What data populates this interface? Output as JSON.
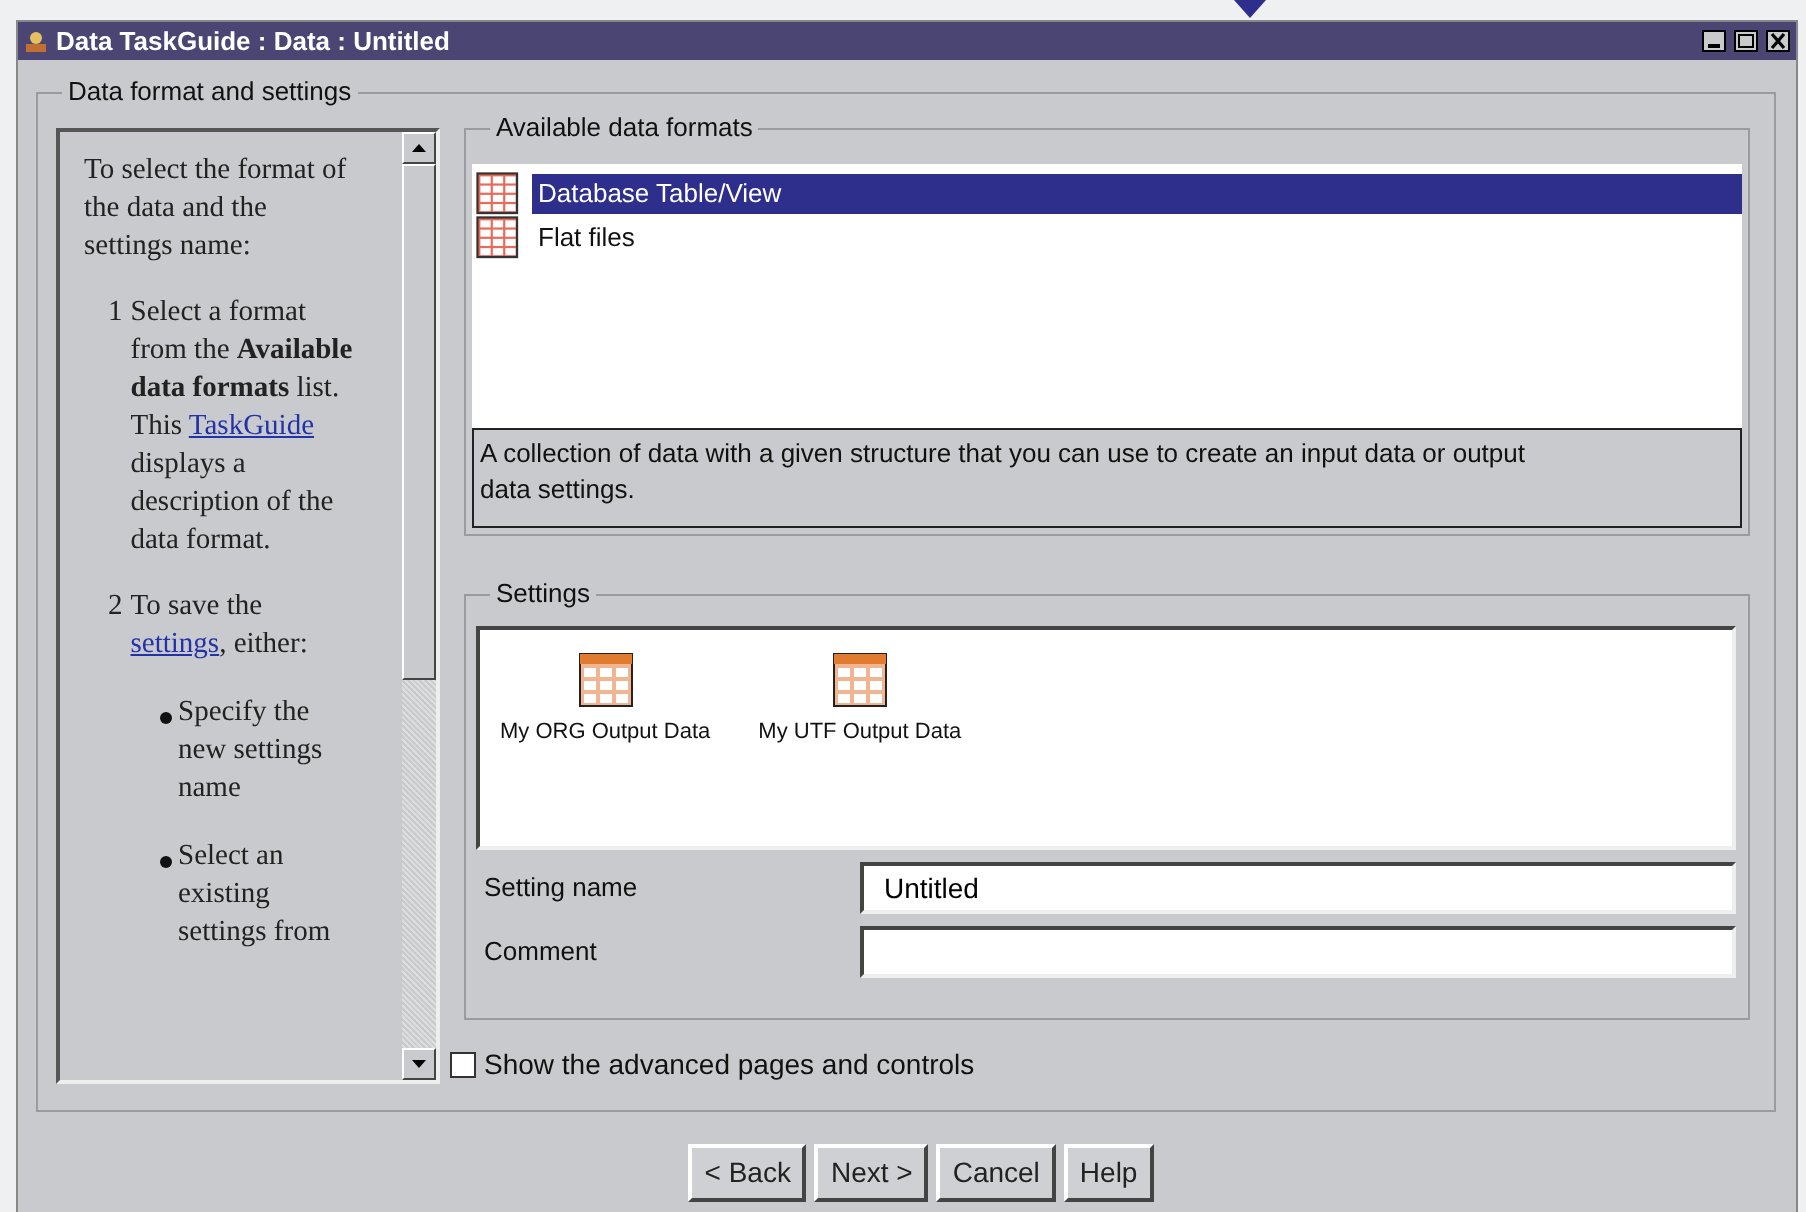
{
  "window": {
    "title": "Data TaskGuide : Data : Untitled"
  },
  "group_title": "Data format and settings",
  "help": {
    "intro": "To select the format of the data and the settings name:",
    "steps": [
      {
        "number": "1",
        "segments": [
          {
            "kind": "text",
            "text": "Select a format from the **Available data formats** list. This "
          },
          {
            "kind": "link",
            "text": "TaskGuide"
          },
          {
            "kind": "text",
            "text": " displays a description of the data format."
          }
        ]
      },
      {
        "number": "2",
        "segments": [
          {
            "kind": "text",
            "text": "To save the "
          },
          {
            "kind": "link",
            "text": "settings"
          },
          {
            "kind": "text",
            "text": ",  either:"
          }
        ],
        "bullets": [
          "Specify the new settings name",
          "Select an existing settings from"
        ]
      }
    ]
  },
  "formats": {
    "title": "Available data formats",
    "items": [
      {
        "label": "Database Table/View",
        "selected": true
      },
      {
        "label": "Flat files",
        "selected": false
      }
    ],
    "description": "A collection of data with a given structure that you can use to create an input data or output data settings."
  },
  "settings": {
    "title": "Settings",
    "items": [
      {
        "label": "My ORG Output Data"
      },
      {
        "label": "My UTF Output Data"
      }
    ],
    "fields": [
      {
        "label": "Setting name",
        "value": "Untitled"
      },
      {
        "label": "Comment"
      }
    ]
  },
  "advanced": {
    "label": "Show the advanced pages and controls",
    "checked": false
  },
  "buttons": [
    "< Back",
    "Next >",
    "Cancel",
    "Help"
  ]
}
